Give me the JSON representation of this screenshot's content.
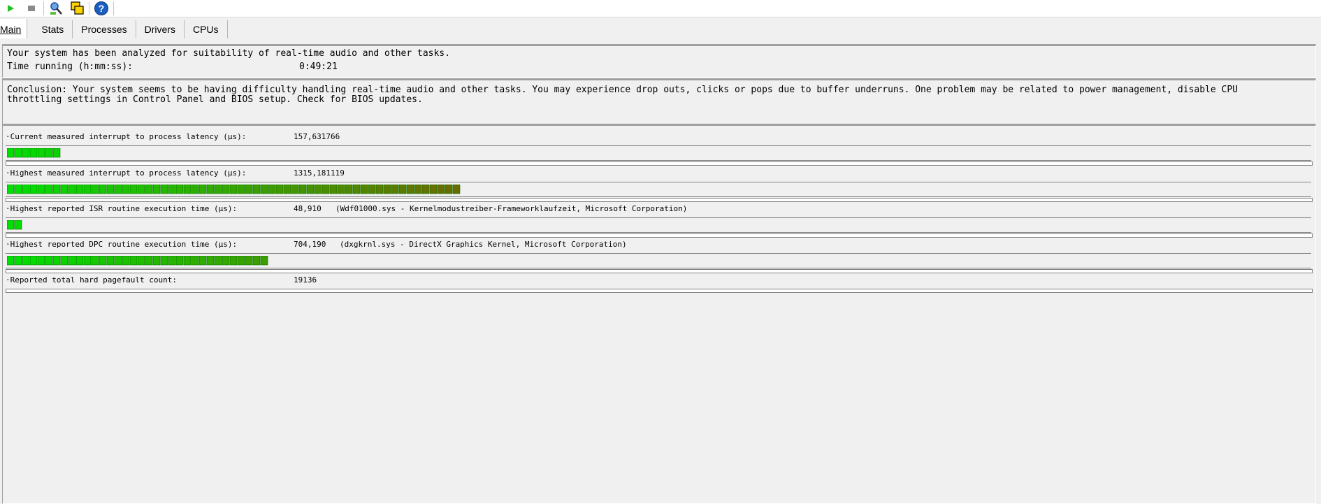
{
  "toolbar": {
    "icons": [
      "play-icon",
      "stop-icon",
      "analyze-icon",
      "window-icon",
      "help-icon"
    ],
    "colors": {
      "play": "#20c020",
      "stop": "#8a8a8a",
      "help": "#1a5fbf"
    }
  },
  "tabs": [
    {
      "label": "Main"
    },
    {
      "label": "Stats"
    },
    {
      "label": "Processes"
    },
    {
      "label": "Drivers"
    },
    {
      "label": "CPUs"
    }
  ],
  "status": {
    "analyzed": "Your system has been analyzed for suitability of real-time audio and other tasks.",
    "time_label": "Time running (h:mm:ss):",
    "time_value": "0:49:21"
  },
  "conclusion": "Conclusion: Your system seems to be having difficulty handling real-time audio and other tasks. You may experience drop outs, clicks or pops due to buffer underruns. One problem may be related to power management, disable CPU throttling settings in Control Panel and BIOS setup. Check for BIOS updates.",
  "metrics": [
    {
      "label": "·Current measured interrupt to process latency (µs):",
      "value": "157,631766",
      "detail": "",
      "bar_fraction": 0.0412
    },
    {
      "label": "·Highest measured interrupt to process latency (µs):",
      "value": "1315,181119",
      "detail": "",
      "bar_fraction": 0.3504
    },
    {
      "label": "·Highest reported ISR routine execution time (µs):",
      "value": "48,910",
      "detail": "(Wdf01000.sys - Kernelmodustreiber-Frameworklaufzeit, Microsoft Corporation)",
      "bar_fraction": 0.012
    },
    {
      "label": "·Highest reported DPC routine execution time (µs):",
      "value": "704,190",
      "detail": "(dxgkrnl.sys - DirectX Graphics Kernel, Microsoft Corporation)",
      "bar_fraction": 0.2008
    },
    {
      "label": "·Reported total hard pagefault count:",
      "value": "19136",
      "detail": "",
      "bar_fraction": null
    }
  ],
  "bar_colors": {
    "start": "#00e000",
    "end": "#6b6b00",
    "border": "#007000"
  }
}
